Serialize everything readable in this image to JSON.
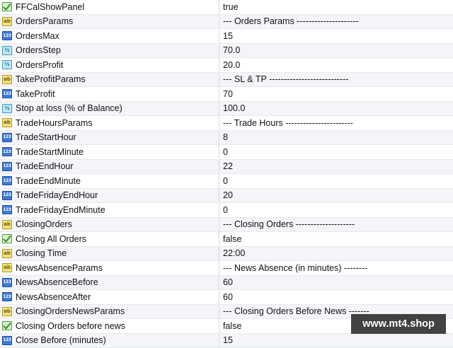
{
  "rows": [
    {
      "name": "FFCalShowPanel",
      "value": "true",
      "icon": "bool-icon"
    },
    {
      "name": "OrdersParams",
      "value": "--- Orders Params ---------------------",
      "icon": "string-icon"
    },
    {
      "name": "OrdersMax",
      "value": "15",
      "icon": "integer-icon"
    },
    {
      "name": "OrdersStep",
      "value": "70.0",
      "icon": "double-icon"
    },
    {
      "name": "OrdersProfit",
      "value": "20.0",
      "icon": "double-icon"
    },
    {
      "name": "TakeProfitParams",
      "value": "--- SL & TP ---------------------------",
      "icon": "string-icon"
    },
    {
      "name": "TakeProfit",
      "value": "70",
      "icon": "integer-icon"
    },
    {
      "name": "Stop at loss (% of Balance)",
      "value": "100.0",
      "icon": "double-icon"
    },
    {
      "name": "TradeHoursParams",
      "value": "--- Trade Hours -----------------------",
      "icon": "string-icon"
    },
    {
      "name": "TradeStartHour",
      "value": "8",
      "icon": "integer-icon"
    },
    {
      "name": "TradeStartMinute",
      "value": "0",
      "icon": "integer-icon"
    },
    {
      "name": "TradeEndHour",
      "value": "22",
      "icon": "integer-icon"
    },
    {
      "name": "TradeEndMinute",
      "value": "0",
      "icon": "integer-icon"
    },
    {
      "name": "TradeFridayEndHour",
      "value": "20",
      "icon": "integer-icon"
    },
    {
      "name": "TradeFridayEndMinute",
      "value": "0",
      "icon": "integer-icon"
    },
    {
      "name": "ClosingOrders",
      "value": "--- Closing Orders --------------------",
      "icon": "string-icon"
    },
    {
      "name": "Closing All Orders",
      "value": "false",
      "icon": "bool-icon"
    },
    {
      "name": "Closing Time",
      "value": "22:00",
      "icon": "string-icon"
    },
    {
      "name": "NewsAbsenceParams",
      "value": "--- News Absence (in minutes) --------",
      "icon": "string-icon"
    },
    {
      "name": "NewsAbsenceBefore",
      "value": "60",
      "icon": "integer-icon"
    },
    {
      "name": "NewsAbsenceAfter",
      "value": "60",
      "icon": "integer-icon"
    },
    {
      "name": "ClosingOrdersNewsParams",
      "value": "--- Closing Orders Before News -------",
      "icon": "string-icon"
    },
    {
      "name": "Closing Orders before news",
      "value": "false",
      "icon": "bool-icon"
    },
    {
      "name": "Close Before (minutes)",
      "value": "15",
      "icon": "integer-icon"
    }
  ],
  "icon_glyphs": {
    "string-icon": "ab",
    "integer-icon": "123",
    "double-icon": "½",
    "bool-icon": ""
  },
  "watermark": "www.mt4.shop"
}
